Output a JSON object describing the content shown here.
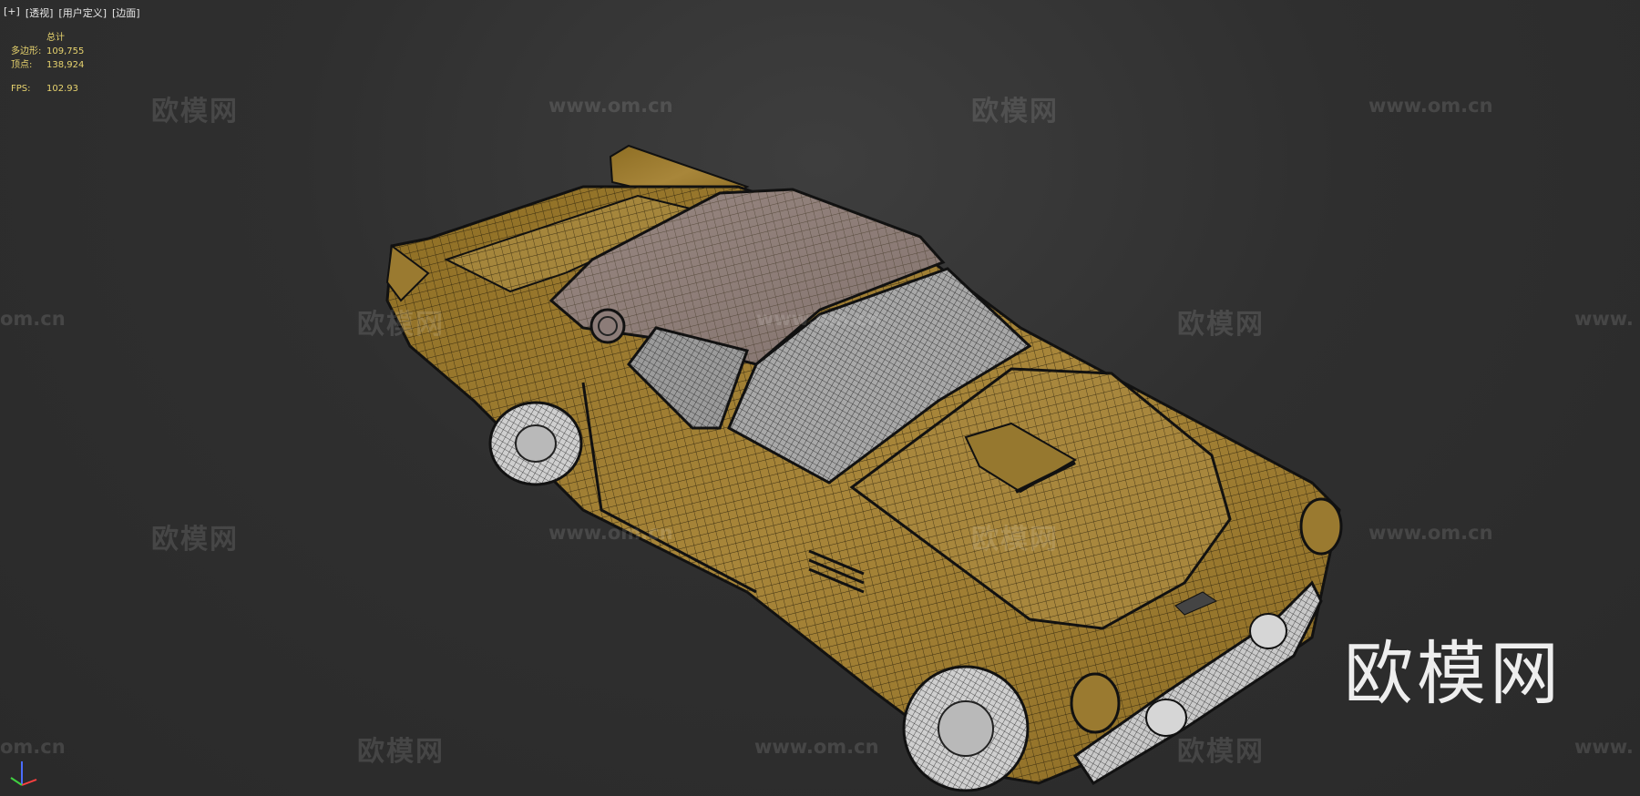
{
  "viewport_menu": {
    "plus": "[+]",
    "view": "[透视]",
    "user_defined": "[用户定义]",
    "shading": "[边面]"
  },
  "stats": {
    "header": "总计",
    "polygons_label": "多边形:",
    "polygons_value": "109,755",
    "vertices_label": "顶点:",
    "vertices_value": "138,924",
    "fps_label": "FPS:",
    "fps_value": "102.93"
  },
  "watermarks": {
    "brand": "欧模网",
    "url": "www.om.cn",
    "url_partial_left": "om.cn",
    "url_partial_right": "www."
  },
  "colors": {
    "background": "#2f2f2f",
    "stats_text": "#e7d36e",
    "car_body": "#9a7a30",
    "car_top": "#8c7c78",
    "glass": "#a6a6a6"
  },
  "icons": {
    "axis_gizmo": "xyz-axis-icon"
  }
}
